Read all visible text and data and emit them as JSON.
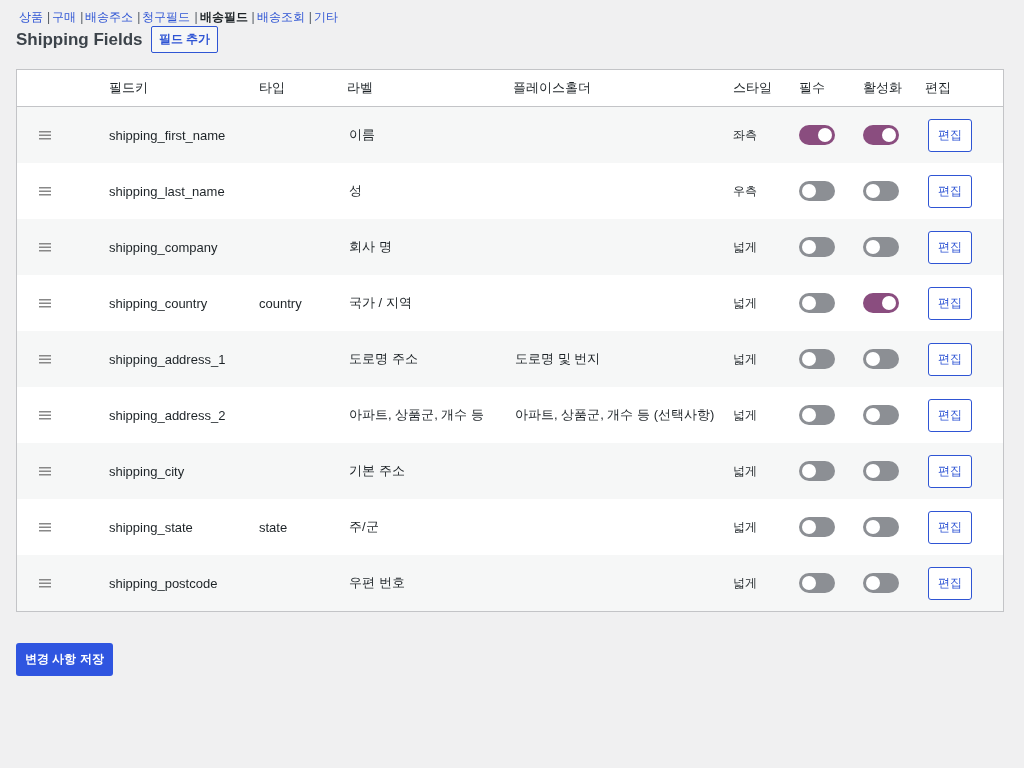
{
  "nav": [
    {
      "label": "상품",
      "selected": false
    },
    {
      "separator": "|",
      "label": "구매",
      "selected": false
    },
    {
      "separator": "|",
      "label": "배송주소",
      "selected": false
    },
    {
      "separator": "|",
      "label": "청구필드",
      "selected": false
    },
    {
      "separator": "|",
      "label": "배송필드",
      "selected": true
    },
    {
      "separator": "|",
      "label": "배송조회",
      "selected": false
    },
    {
      "separator": "|",
      "label": "기타",
      "selected": false
    }
  ],
  "title": "Shipping Fields",
  "add_button": "필드 추가",
  "table": {
    "columns": [
      "필드키",
      "타입",
      "라벨",
      "플레이스홀더",
      "스타일",
      "필수",
      "활성화",
      "편집"
    ],
    "rows": [
      {
        "key": "shipping_first_name",
        "type": "",
        "label": "이름",
        "placeholder": "",
        "style": "좌측",
        "required": true,
        "enabled": true,
        "edit": "편집"
      },
      {
        "key": "shipping_last_name",
        "type": "",
        "label": "성",
        "placeholder": "",
        "style": "우측",
        "required": false,
        "enabled": false,
        "edit": "편집"
      },
      {
        "key": "shipping_company",
        "type": "",
        "label": "회사 명",
        "placeholder": "",
        "style": "넓게",
        "required": false,
        "enabled": false,
        "edit": "편집"
      },
      {
        "key": "shipping_country",
        "type": "country",
        "label": "국가 / 지역",
        "placeholder": "",
        "style": "넓게",
        "required": false,
        "enabled": true,
        "edit": "편집"
      },
      {
        "key": "shipping_address_1",
        "type": "",
        "label": "도로명 주소",
        "placeholder": "도로명 및 번지",
        "style": "넓게",
        "required": false,
        "enabled": false,
        "edit": "편집"
      },
      {
        "key": "shipping_address_2",
        "type": "",
        "label": "아파트, 상품군, 개수 등",
        "placeholder": "아파트, 상품군, 개수 등 (선택사항)",
        "style": "넓게",
        "required": false,
        "enabled": false,
        "edit": "편집"
      },
      {
        "key": "shipping_city",
        "type": "",
        "label": "기본 주소",
        "placeholder": "",
        "style": "넓게",
        "required": false,
        "enabled": false,
        "edit": "편집"
      },
      {
        "key": "shipping_state",
        "type": "state",
        "label": "주/군",
        "placeholder": "",
        "style": "넓게",
        "required": false,
        "enabled": false,
        "edit": "편집"
      },
      {
        "key": "shipping_postcode",
        "type": "",
        "label": "우편 번호",
        "placeholder": "",
        "style": "넓게",
        "required": false,
        "enabled": false,
        "edit": "편집"
      }
    ]
  },
  "save_button": "변경 사항 저장"
}
